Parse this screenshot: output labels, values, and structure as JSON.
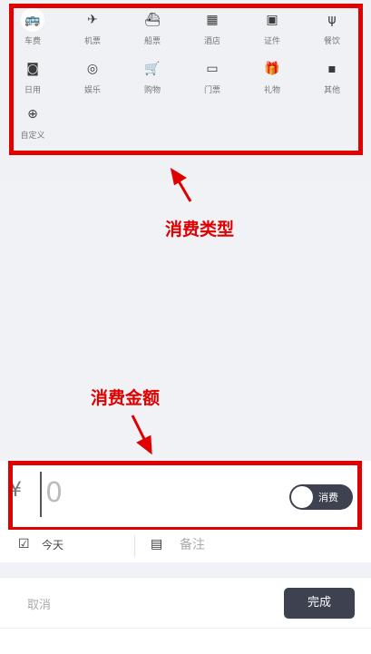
{
  "categories": {
    "row1": [
      {
        "label": "车费",
        "icon": "bus-icon",
        "glyph": "🚌",
        "selected": true
      },
      {
        "label": "机票",
        "icon": "plane-icon",
        "glyph": "✈"
      },
      {
        "label": "船票",
        "icon": "ship-icon",
        "glyph": "⛴"
      },
      {
        "label": "酒店",
        "icon": "building-icon",
        "glyph": "▦"
      },
      {
        "label": "证件",
        "icon": "id-card-icon",
        "glyph": "▣"
      },
      {
        "label": "餐饮",
        "icon": "fork-knife-icon",
        "glyph": "ψ"
      }
    ],
    "row2": [
      {
        "label": "日用",
        "icon": "toilet-paper-icon",
        "glyph": "◙"
      },
      {
        "label": "娱乐",
        "icon": "dart-icon",
        "glyph": "◎"
      },
      {
        "label": "购物",
        "icon": "cart-icon",
        "glyph": "🛒"
      },
      {
        "label": "门票",
        "icon": "ticket-icon",
        "glyph": "▭"
      },
      {
        "label": "礼物",
        "icon": "gift-icon",
        "glyph": "🎁"
      },
      {
        "label": "其他",
        "icon": "grid-icon",
        "glyph": "▪"
      }
    ],
    "row3": [
      {
        "label": "自定义",
        "icon": "plus-circle-icon",
        "glyph": "⊕"
      }
    ]
  },
  "annotations": {
    "type_label": "消费类型",
    "amount_label": "消费金额"
  },
  "amount": {
    "currency": "¥",
    "value": "0",
    "toggle_label": "消费"
  },
  "meta": {
    "date_label": "今天",
    "note_placeholder": "备注"
  },
  "actions": {
    "cancel_label": "取消",
    "done_label": "完成"
  },
  "colors": {
    "highlight": "#e00000",
    "dark": "#3d4150"
  }
}
